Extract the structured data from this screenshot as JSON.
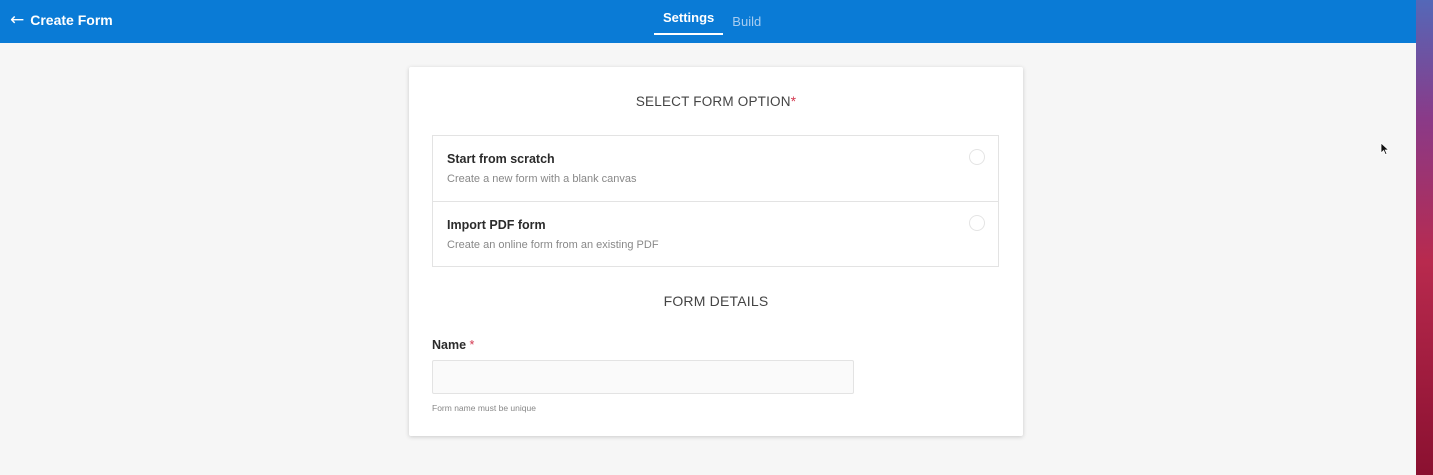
{
  "header": {
    "back_title": "Create Form",
    "tabs": [
      {
        "label": "Settings",
        "active": true
      },
      {
        "label": "Build",
        "active": false
      }
    ]
  },
  "form": {
    "option_section_title": "SELECT FORM OPTION",
    "required_mark": "*",
    "options": [
      {
        "title": "Start from scratch",
        "description": "Create a new form with a blank canvas",
        "selected": false
      },
      {
        "title": "Import PDF form",
        "description": "Create an online form from an existing PDF",
        "selected": false
      }
    ],
    "details_section_title": "FORM DETAILS",
    "name_label": "Name",
    "name_value": "",
    "name_help": "Form name must be unique"
  },
  "icons": {
    "back": "arrow-left-icon",
    "cursor": "mouse-pointer-icon"
  },
  "colors": {
    "header_bg": "#0a7bd6",
    "required": "#d3374f"
  }
}
